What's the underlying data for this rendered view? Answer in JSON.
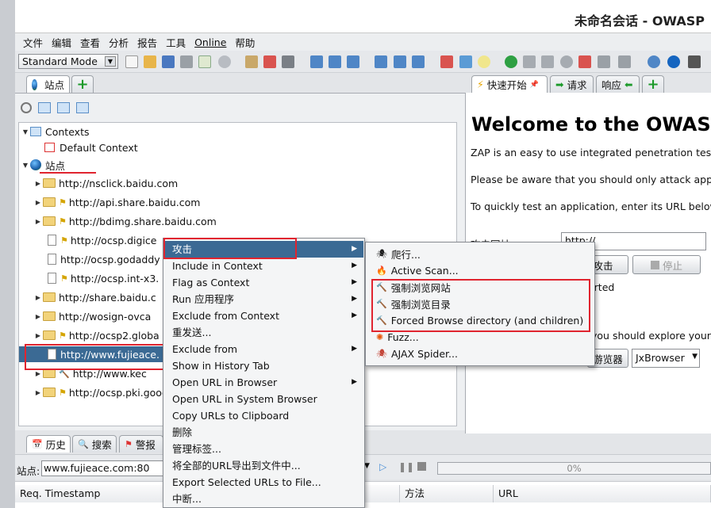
{
  "window": {
    "title": "未命名会话 - OWASP"
  },
  "menubar": {
    "items": [
      "文件",
      "编辑",
      "查看",
      "分析",
      "报告",
      "工具",
      "Online",
      "帮助"
    ]
  },
  "toolbar": {
    "mode": "Standard Mode"
  },
  "left_tabs": {
    "sites": "站点"
  },
  "right_tabs": {
    "quick_start": "快速开始",
    "request": "请求",
    "response": "响应"
  },
  "tree": {
    "contexts": "Contexts",
    "default_context": "Default Context",
    "sites": "站点",
    "nodes": [
      "http://nsclick.baidu.com",
      "http://api.share.baidu.com",
      "http://bdimg.share.baidu.com",
      "http://ocsp.digice",
      "http://ocsp.godaddy",
      "http://ocsp.int-x3.",
      "http://share.baidu.c",
      "http://wosign-ovca",
      "http://ocsp2.globa",
      "http://www.fujieace.",
      "http://www.kec",
      "http://ocsp.pki.goog"
    ]
  },
  "welcome": {
    "title": "Welcome to the OWASP",
    "line1": "ZAP is an easy to use integrated penetration tes",
    "line2": "Please be aware that you should only attack app",
    "line3": "To quickly test an application, enter its URL below",
    "url_label": "攻击网址：",
    "url_value": "http://",
    "attack_btn": "攻击",
    "stop_btn": "停止",
    "started_text": "arted",
    "explore_text": "you should explore your",
    "browser_btn": "游览器",
    "browser_select": "JxBrowser"
  },
  "bottom_tabs": {
    "history": "历史",
    "search": "搜索",
    "alerts": "警报"
  },
  "status": {
    "site_label": "站点:",
    "site_value": "www.fujieace.com:80",
    "progress": "0%"
  },
  "history": {
    "col_timestamp": "Req. Timestamp",
    "col_method": "方法",
    "col_url": "URL"
  },
  "context_menu": {
    "items": [
      "攻击",
      "Include in Context",
      "Flag as Context",
      "Run 应用程序",
      "Exclude from Context",
      "重发送...",
      "Exclude from",
      "Show in History Tab",
      "Open URL in Browser",
      "Open URL in System Browser",
      "Copy URLs to Clipboard",
      "删除",
      "管理标签...",
      "将全部的URL导出到文件中...",
      "Export Selected URLs to File...",
      "中断..."
    ]
  },
  "attack_submenu": {
    "items": [
      "爬行...",
      "Active Scan...",
      "强制浏览网站",
      "强制浏览目录",
      "Forced Browse directory (and children)",
      "Fuzz...",
      "AJAX Spider..."
    ]
  },
  "colors": {
    "selection": "#3b6a94",
    "annotation_red": "#e0242f"
  }
}
